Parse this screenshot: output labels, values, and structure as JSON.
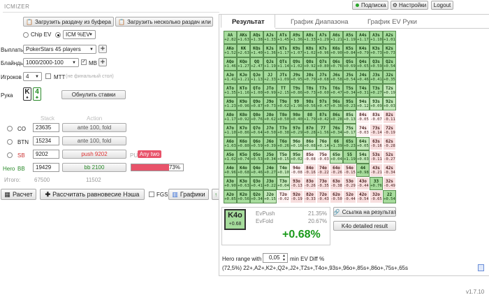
{
  "header": {
    "logo": "ICMIZER",
    "subscription": "Подписка",
    "settings": "Настройки",
    "logout": "Logout"
  },
  "toolbar": {
    "load_clipboard": "Загрузить раздачу из буфера",
    "load_multiple": "Загрузить несколько раздач или тур"
  },
  "mode": {
    "chip_ev": "Chip EV",
    "icm_ev": "ICM %EV",
    "selected": "ICM %EV"
  },
  "form": {
    "payouts_label": "Выплаты",
    "payouts_value": "PokerStars 45 players",
    "blinds_label": "Блайнды",
    "blinds_value": "1000/2000-100",
    "mb_label": "MB",
    "players_label": "Игроков",
    "players_value": "4",
    "mtt_label": "MTT",
    "mtt_note": "(не финальный стол)",
    "hand_label": "Рука",
    "hand_card1": "K",
    "hand_card2": "4",
    "reset_bets": "Обнулить ставки"
  },
  "table": {
    "col_stack": "Stack",
    "col_action": "Action",
    "rows": [
      {
        "pos": "CO",
        "stack": "23635",
        "action": "ante 100, fold"
      },
      {
        "pos": "BTN",
        "stack": "15234",
        "action": "ante 100, fold"
      },
      {
        "pos": "SB",
        "stack": "9202",
        "action": "push 9202",
        "pu": "PU",
        "range": "Any two"
      },
      {
        "hero": "Hero",
        "pos": "BB",
        "stack": "19429",
        "action": "bb 2100",
        "percent": "73%"
      }
    ],
    "total_label": "Итого:",
    "total_stack": "67500",
    "total_action": "11502"
  },
  "bottom": {
    "calc": "Расчет",
    "nash": "Рассчитать равновесие Нэша",
    "fgs": "FGS",
    "graphs": "Графики"
  },
  "tabs": {
    "result": "Результат",
    "range_chart": "График Диапазона",
    "ev_chart": "График EV Руки"
  },
  "grid": [
    [
      [
        "AA",
        "+2.82"
      ],
      [
        "AKs",
        "+1.63"
      ],
      [
        "AQs",
        "+1.38"
      ],
      [
        "AJs",
        "+1.33"
      ],
      [
        "ATs",
        "+1.45"
      ],
      [
        "A9s",
        "+1.36"
      ],
      [
        "A8s",
        "+1.33"
      ],
      [
        "A7s",
        "+1.29"
      ],
      [
        "A6s",
        "+1.21"
      ],
      [
        "A5s",
        "+1.19"
      ],
      [
        "A4s",
        "+1.17"
      ],
      [
        "A3s",
        "+1.10"
      ],
      [
        "A2s",
        "+1.01"
      ]
    ],
    [
      [
        "AKo",
        "+1.52"
      ],
      [
        "KK",
        "+2.63"
      ],
      [
        "KQs",
        "+1.40"
      ],
      [
        "KJs",
        "+1.36"
      ],
      [
        "KTs",
        "+1.17"
      ],
      [
        "K9s",
        "+1.07"
      ],
      [
        "K8s",
        "+1.02"
      ],
      [
        "K7s",
        "+0.96"
      ],
      [
        "K6s",
        "+0.90"
      ],
      [
        "K5s",
        "+0.84"
      ],
      [
        "K4s",
        "+0.79"
      ],
      [
        "K3s",
        "+0.73"
      ],
      [
        "K2s",
        "+0.73"
      ]
    ],
    [
      [
        "AQo",
        "+1.46"
      ],
      [
        "KQo",
        "+1.27"
      ],
      [
        "QQ",
        "+2.47"
      ],
      [
        "QJs",
        "+1.19"
      ],
      [
        "QTs",
        "+1.14"
      ],
      [
        "Q9s",
        "+1.02"
      ],
      [
        "Q8s",
        "+0.92"
      ],
      [
        "Q7s",
        "+0.80"
      ],
      [
        "Q6s",
        "+0.76"
      ],
      [
        "Q5s",
        "+0.69"
      ],
      [
        "Q4s",
        "+0.65"
      ],
      [
        "Q3s",
        "+0.59"
      ],
      [
        "Q2s",
        "+0.54"
      ]
    ],
    [
      [
        "AJo",
        "+1.41"
      ],
      [
        "KJo",
        "+1.21"
      ],
      [
        "QJo",
        "+1.13"
      ],
      [
        "JJ",
        "+2.33"
      ],
      [
        "JTs",
        "+1.09"
      ],
      [
        "J9s",
        "+0.95"
      ],
      [
        "J8s",
        "+0.79"
      ],
      [
        "J7s",
        "+0.68"
      ],
      [
        "J6s",
        "+0.58"
      ],
      [
        "J5s",
        "+0.54"
      ],
      [
        "J4s",
        "+0.46"
      ],
      [
        "J3s",
        "+0.41"
      ],
      [
        "J2s",
        "+0.35"
      ]
    ],
    [
      [
        "ATo",
        "+1.35"
      ],
      [
        "KTo",
        "+1.16"
      ],
      [
        "QTo",
        "+1.00"
      ],
      [
        "JTo",
        "+0.99"
      ],
      [
        "TT",
        "+2.15"
      ],
      [
        "T9s",
        "+0.86"
      ],
      [
        "T8s",
        "+0.73"
      ],
      [
        "T7s",
        "+0.60"
      ],
      [
        "T6s",
        "+0.47"
      ],
      [
        "T5s",
        "+0.34"
      ],
      [
        "T4s",
        "+0.31"
      ],
      [
        "T3s",
        "+0.27"
      ],
      [
        "T2s",
        "+0.19"
      ]
    ],
    [
      [
        "A9o",
        "+1.23"
      ],
      [
        "K9o",
        "+0.96"
      ],
      [
        "Q9o",
        "+0.87"
      ],
      [
        "J9o",
        "+0.73"
      ],
      [
        "T9o",
        "+0.62"
      ],
      [
        "99",
        "+1.96"
      ],
      [
        "98s",
        "+0.56"
      ],
      [
        "97s",
        "+0.47"
      ],
      [
        "96s",
        "+0.36"
      ],
      [
        "95s",
        "+0.23"
      ],
      [
        "94s",
        "+0.12"
      ],
      [
        "93s",
        "+0.09"
      ],
      [
        "92s",
        "+0.03"
      ]
    ],
    [
      [
        "A8o",
        "+1.17"
      ],
      [
        "K8o",
        "+0.92"
      ],
      [
        "Q8o",
        "+0.76"
      ],
      [
        "J8o",
        "+0.62"
      ],
      [
        "T8o",
        "+0.50"
      ],
      [
        "98o",
        "+0.40"
      ],
      [
        "88",
        "+1.79"
      ],
      [
        "87s",
        "+0.42"
      ],
      [
        "86s",
        "+0.28"
      ],
      [
        "85s",
        "+0.13"
      ],
      [
        "84s",
        "-0.05"
      ],
      [
        "83s",
        "-0.07"
      ],
      [
        "82s",
        "-0.11"
      ]
    ],
    [
      [
        "A7o",
        "+1.10"
      ],
      [
        "K7o",
        "+0.86"
      ],
      [
        "Q7o",
        "+0.64"
      ],
      [
        "J7o",
        "+0.50"
      ],
      [
        "T7o",
        "+0.38"
      ],
      [
        "97o",
        "+0.29"
      ],
      [
        "87o",
        "+0.28"
      ],
      [
        "77",
        "+1.56"
      ],
      [
        "76s",
        "+0.34"
      ],
      [
        "75s",
        "+0.17"
      ],
      [
        "74s",
        "-0.03"
      ],
      [
        "73s",
        "-0.14"
      ],
      [
        "72s",
        "-0.19"
      ]
    ],
    [
      [
        "A6o",
        "+1.03"
      ],
      [
        "K6o",
        "+0.80"
      ],
      [
        "Q6o",
        "+0.59"
      ],
      [
        "J6o",
        "+0.39"
      ],
      [
        "T6o",
        "+0.26"
      ],
      [
        "96o",
        "+0.16"
      ],
      [
        "86o",
        "+0.08"
      ],
      [
        "76o",
        "+0.14"
      ],
      [
        "66",
        "+1.39"
      ],
      [
        "65s",
        "+0.23"
      ],
      [
        "64s",
        "+0.05"
      ],
      [
        "63s",
        "-0.16"
      ],
      [
        "62s",
        "-0.28"
      ]
    ],
    [
      [
        "A5o",
        "+1.02"
      ],
      [
        "K5o",
        "+0.74"
      ],
      [
        "Q5o",
        "+0.53"
      ],
      [
        "J5o",
        "+0.34"
      ],
      [
        "T5o",
        "+0.15"
      ],
      [
        "95o",
        "+0.02"
      ],
      [
        "85o",
        "-0.08"
      ],
      [
        "75o",
        "-0.03"
      ],
      [
        "65o",
        "+0.04"
      ],
      [
        "55",
        "+1.19"
      ],
      [
        "54s",
        "+0.03"
      ],
      [
        "53s",
        "-0.11"
      ],
      [
        "52s",
        "-0.27"
      ]
    ],
    [
      [
        "A4o",
        "+0.96"
      ],
      [
        "K4o",
        "+0.68"
      ],
      [
        "Q4o",
        "+0.46"
      ],
      [
        "J4o",
        "+0.27"
      ],
      [
        "T4o",
        "+0.10"
      ],
      [
        "94o",
        "-0.08"
      ],
      [
        "84o",
        "-0.16"
      ],
      [
        "74o",
        "-0.22"
      ],
      [
        "64o",
        "-0.26"
      ],
      [
        "54o",
        "-0.15"
      ],
      [
        "44",
        "+0.98"
      ],
      [
        "43s",
        "-0.21"
      ],
      [
        "42s",
        "-0.34"
      ]
    ],
    [
      [
        "A3o",
        "+0.90"
      ],
      [
        "K3o",
        "+0.63"
      ],
      [
        "Q3o",
        "+0.41"
      ],
      [
        "J3o",
        "+0.22"
      ],
      [
        "T3o",
        "+0.04"
      ],
      [
        "93o",
        "-0.13"
      ],
      [
        "83o",
        "-0.26"
      ],
      [
        "73o",
        "-0.35"
      ],
      [
        "63o",
        "-0.38"
      ],
      [
        "53o",
        "-0.29"
      ],
      [
        "43o",
        "-0.44"
      ],
      [
        "33",
        "+0.76"
      ],
      [
        "32s",
        "-0.49"
      ]
    ],
    [
      [
        "A2o",
        "+0.85"
      ],
      [
        "K2o",
        "+0.56"
      ],
      [
        "Q2o",
        "+0.34"
      ],
      [
        "J2o",
        "+0.15"
      ],
      [
        "T2o",
        "-0.02"
      ],
      [
        "92o",
        "-0.19"
      ],
      [
        "82o",
        "-0.33"
      ],
      [
        "72o",
        "-0.43"
      ],
      [
        "62o",
        "-0.50"
      ],
      [
        "52o",
        "-0.44"
      ],
      [
        "42o",
        "-0.54"
      ],
      [
        "32o",
        "-0.65"
      ],
      [
        "22",
        "+0.54"
      ]
    ]
  ],
  "hand_result": {
    "hand": "K4o",
    "ev": "+0.68",
    "evpush_label": "EvPush",
    "evpush_value": "21.35%",
    "evfold_label": "EvFold",
    "evfold_value": "20.67%",
    "diff": "+0.68%"
  },
  "result_buttons": {
    "link": "Ссылка на результат",
    "detailed": "K4o detailed result"
  },
  "hero_range": {
    "label": "Hero range with",
    "value": "0,05",
    "suffix": "min EV Diff %",
    "range_text": "(72,5%) 22+,A2+,K2+,Q2+,J2+,T2s+,T4o+,93s+,96o+,85s+,86o+,75s+,65s"
  },
  "footer": {
    "version": "v1.7.10"
  },
  "colors": {
    "positive": "#a6dc9c",
    "negative": "#f7dede",
    "push_red": "#d9534f",
    "diff_green": "#1a9a1a"
  }
}
